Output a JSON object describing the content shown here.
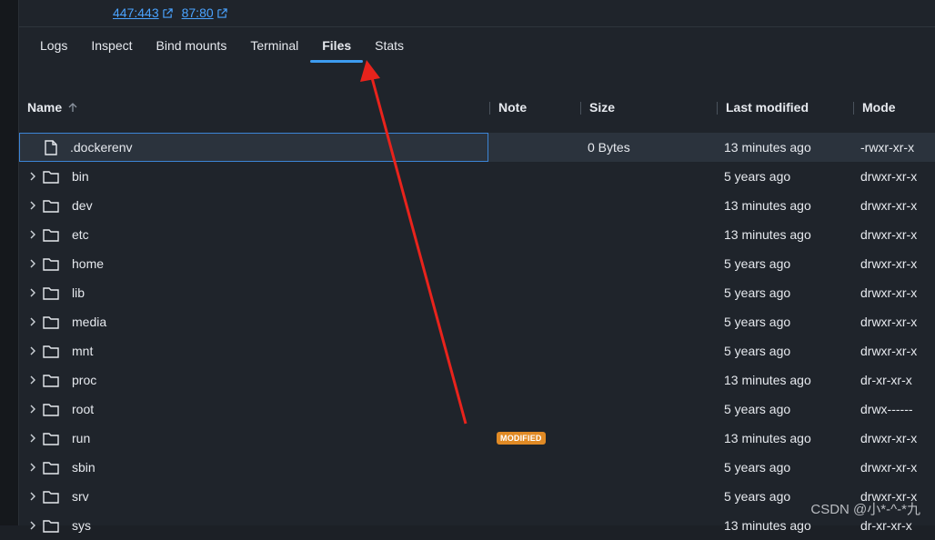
{
  "ports": [
    {
      "label": "447:443"
    },
    {
      "label": "87:80"
    }
  ],
  "tabs": [
    {
      "label": "Logs"
    },
    {
      "label": "Inspect"
    },
    {
      "label": "Bind mounts"
    },
    {
      "label": "Terminal"
    },
    {
      "label": "Files"
    },
    {
      "label": "Stats"
    }
  ],
  "active_tab": "Files",
  "columns": {
    "name": "Name",
    "note": "Note",
    "size": "Size",
    "modified": "Last modified",
    "mode": "Mode"
  },
  "rows": [
    {
      "name": ".dockerenv",
      "type": "file",
      "size": "0 Bytes",
      "modified": "13 minutes ago",
      "mode": "-rwxr-xr-x",
      "note": ""
    },
    {
      "name": "bin",
      "type": "folder",
      "size": "",
      "modified": "5 years ago",
      "mode": "drwxr-xr-x",
      "note": ""
    },
    {
      "name": "dev",
      "type": "folder",
      "size": "",
      "modified": "13 minutes ago",
      "mode": "drwxr-xr-x",
      "note": ""
    },
    {
      "name": "etc",
      "type": "folder",
      "size": "",
      "modified": "13 minutes ago",
      "mode": "drwxr-xr-x",
      "note": ""
    },
    {
      "name": "home",
      "type": "folder",
      "size": "",
      "modified": "5 years ago",
      "mode": "drwxr-xr-x",
      "note": ""
    },
    {
      "name": "lib",
      "type": "folder",
      "size": "",
      "modified": "5 years ago",
      "mode": "drwxr-xr-x",
      "note": ""
    },
    {
      "name": "media",
      "type": "folder",
      "size": "",
      "modified": "5 years ago",
      "mode": "drwxr-xr-x",
      "note": ""
    },
    {
      "name": "mnt",
      "type": "folder",
      "size": "",
      "modified": "5 years ago",
      "mode": "drwxr-xr-x",
      "note": ""
    },
    {
      "name": "proc",
      "type": "folder",
      "size": "",
      "modified": "13 minutes ago",
      "mode": "dr-xr-xr-x",
      "note": ""
    },
    {
      "name": "root",
      "type": "folder",
      "size": "",
      "modified": "5 years ago",
      "mode": "drwx------",
      "note": ""
    },
    {
      "name": "run",
      "type": "folder",
      "size": "",
      "modified": "13 minutes ago",
      "mode": "drwxr-xr-x",
      "note": "MODIFIED"
    },
    {
      "name": "sbin",
      "type": "folder",
      "size": "",
      "modified": "5 years ago",
      "mode": "drwxr-xr-x",
      "note": ""
    },
    {
      "name": "srv",
      "type": "folder",
      "size": "",
      "modified": "5 years ago",
      "mode": "drwxr-xr-x",
      "note": ""
    },
    {
      "name": "sys",
      "type": "folder",
      "size": "",
      "modified": "13 minutes ago",
      "mode": "dr-xr-xr-x",
      "note": ""
    }
  ],
  "watermark": "CSDN @小*-^-*九",
  "colors": {
    "accent": "#3d9cf0",
    "badge": "#e08a25",
    "annotation_arrow": "#e8231c"
  }
}
